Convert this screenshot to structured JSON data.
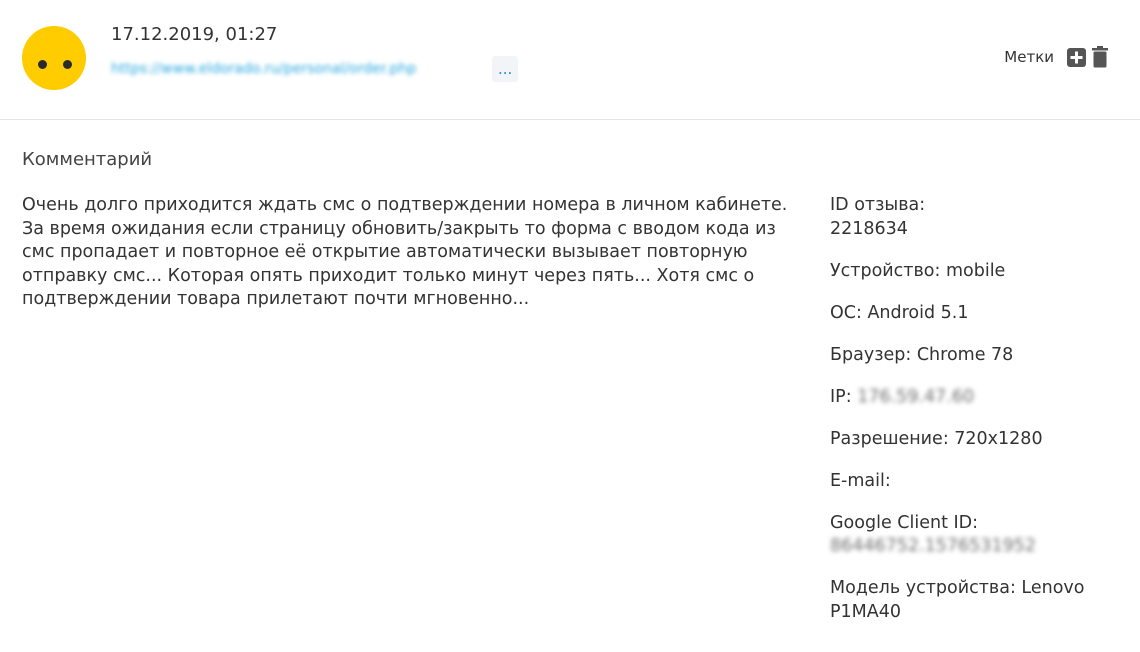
{
  "review": {
    "date": "17.12.2019, 01:27",
    "url": "https://www.eldorado.ru/personal/order.php",
    "more_label": "...",
    "avatar_color": "#ffcc00"
  },
  "toolbar": {
    "tags_label": "Метки",
    "add_icon": "plus-square-icon",
    "delete_icon": "trash-icon"
  },
  "comment": {
    "title": "Комментарий",
    "text": "Очень долго приходится ждать смс о подтверждении номера в личном кабинете. За время ожидания если страницу обновить/закрыть то форма с вводом кода из смс пропадает и повторное её открытие автоматически вызывает повторную отправку смс... Которая опять приходит только минут через пять... Хотя смс о подтверждении товара прилетают почти мгновенно..."
  },
  "meta": {
    "id_label": "ID отзыва:",
    "id_value": "2218634",
    "device": "Устройство: mobile",
    "os": "ОС: Android 5.1",
    "browser": "Браузер: Chrome 78",
    "ip_label": "IP:",
    "ip_value": "176.59.47.60",
    "resolution": "Разрешение: 720x1280",
    "email_label": "E-mail:",
    "gcid_label": "Google Client ID:",
    "gcid_value": "86446752.1576531952",
    "model": "Модель устройства: Lenovo P1MA40"
  }
}
